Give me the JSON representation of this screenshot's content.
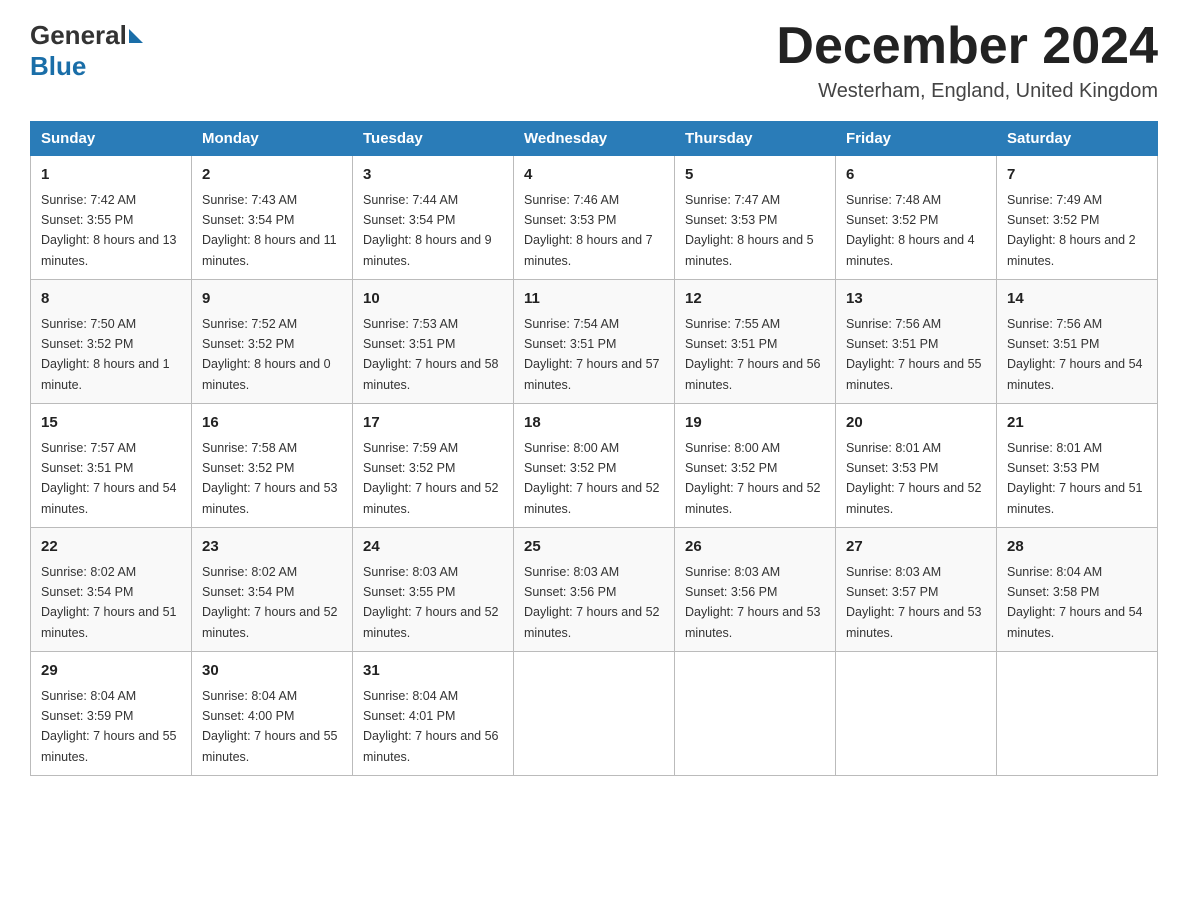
{
  "header": {
    "logo_general": "General",
    "logo_blue": "Blue",
    "month_title": "December 2024",
    "location": "Westerham, England, United Kingdom"
  },
  "weekdays": [
    "Sunday",
    "Monday",
    "Tuesday",
    "Wednesday",
    "Thursday",
    "Friday",
    "Saturday"
  ],
  "weeks": [
    [
      {
        "day": "1",
        "sunrise": "7:42 AM",
        "sunset": "3:55 PM",
        "daylight": "8 hours and 13 minutes."
      },
      {
        "day": "2",
        "sunrise": "7:43 AM",
        "sunset": "3:54 PM",
        "daylight": "8 hours and 11 minutes."
      },
      {
        "day": "3",
        "sunrise": "7:44 AM",
        "sunset": "3:54 PM",
        "daylight": "8 hours and 9 minutes."
      },
      {
        "day": "4",
        "sunrise": "7:46 AM",
        "sunset": "3:53 PM",
        "daylight": "8 hours and 7 minutes."
      },
      {
        "day": "5",
        "sunrise": "7:47 AM",
        "sunset": "3:53 PM",
        "daylight": "8 hours and 5 minutes."
      },
      {
        "day": "6",
        "sunrise": "7:48 AM",
        "sunset": "3:52 PM",
        "daylight": "8 hours and 4 minutes."
      },
      {
        "day": "7",
        "sunrise": "7:49 AM",
        "sunset": "3:52 PM",
        "daylight": "8 hours and 2 minutes."
      }
    ],
    [
      {
        "day": "8",
        "sunrise": "7:50 AM",
        "sunset": "3:52 PM",
        "daylight": "8 hours and 1 minute."
      },
      {
        "day": "9",
        "sunrise": "7:52 AM",
        "sunset": "3:52 PM",
        "daylight": "8 hours and 0 minutes."
      },
      {
        "day": "10",
        "sunrise": "7:53 AM",
        "sunset": "3:51 PM",
        "daylight": "7 hours and 58 minutes."
      },
      {
        "day": "11",
        "sunrise": "7:54 AM",
        "sunset": "3:51 PM",
        "daylight": "7 hours and 57 minutes."
      },
      {
        "day": "12",
        "sunrise": "7:55 AM",
        "sunset": "3:51 PM",
        "daylight": "7 hours and 56 minutes."
      },
      {
        "day": "13",
        "sunrise": "7:56 AM",
        "sunset": "3:51 PM",
        "daylight": "7 hours and 55 minutes."
      },
      {
        "day": "14",
        "sunrise": "7:56 AM",
        "sunset": "3:51 PM",
        "daylight": "7 hours and 54 minutes."
      }
    ],
    [
      {
        "day": "15",
        "sunrise": "7:57 AM",
        "sunset": "3:51 PM",
        "daylight": "7 hours and 54 minutes."
      },
      {
        "day": "16",
        "sunrise": "7:58 AM",
        "sunset": "3:52 PM",
        "daylight": "7 hours and 53 minutes."
      },
      {
        "day": "17",
        "sunrise": "7:59 AM",
        "sunset": "3:52 PM",
        "daylight": "7 hours and 52 minutes."
      },
      {
        "day": "18",
        "sunrise": "8:00 AM",
        "sunset": "3:52 PM",
        "daylight": "7 hours and 52 minutes."
      },
      {
        "day": "19",
        "sunrise": "8:00 AM",
        "sunset": "3:52 PM",
        "daylight": "7 hours and 52 minutes."
      },
      {
        "day": "20",
        "sunrise": "8:01 AM",
        "sunset": "3:53 PM",
        "daylight": "7 hours and 52 minutes."
      },
      {
        "day": "21",
        "sunrise": "8:01 AM",
        "sunset": "3:53 PM",
        "daylight": "7 hours and 51 minutes."
      }
    ],
    [
      {
        "day": "22",
        "sunrise": "8:02 AM",
        "sunset": "3:54 PM",
        "daylight": "7 hours and 51 minutes."
      },
      {
        "day": "23",
        "sunrise": "8:02 AM",
        "sunset": "3:54 PM",
        "daylight": "7 hours and 52 minutes."
      },
      {
        "day": "24",
        "sunrise": "8:03 AM",
        "sunset": "3:55 PM",
        "daylight": "7 hours and 52 minutes."
      },
      {
        "day": "25",
        "sunrise": "8:03 AM",
        "sunset": "3:56 PM",
        "daylight": "7 hours and 52 minutes."
      },
      {
        "day": "26",
        "sunrise": "8:03 AM",
        "sunset": "3:56 PM",
        "daylight": "7 hours and 53 minutes."
      },
      {
        "day": "27",
        "sunrise": "8:03 AM",
        "sunset": "3:57 PM",
        "daylight": "7 hours and 53 minutes."
      },
      {
        "day": "28",
        "sunrise": "8:04 AM",
        "sunset": "3:58 PM",
        "daylight": "7 hours and 54 minutes."
      }
    ],
    [
      {
        "day": "29",
        "sunrise": "8:04 AM",
        "sunset": "3:59 PM",
        "daylight": "7 hours and 55 minutes."
      },
      {
        "day": "30",
        "sunrise": "8:04 AM",
        "sunset": "4:00 PM",
        "daylight": "7 hours and 55 minutes."
      },
      {
        "day": "31",
        "sunrise": "8:04 AM",
        "sunset": "4:01 PM",
        "daylight": "7 hours and 56 minutes."
      },
      null,
      null,
      null,
      null
    ]
  ]
}
